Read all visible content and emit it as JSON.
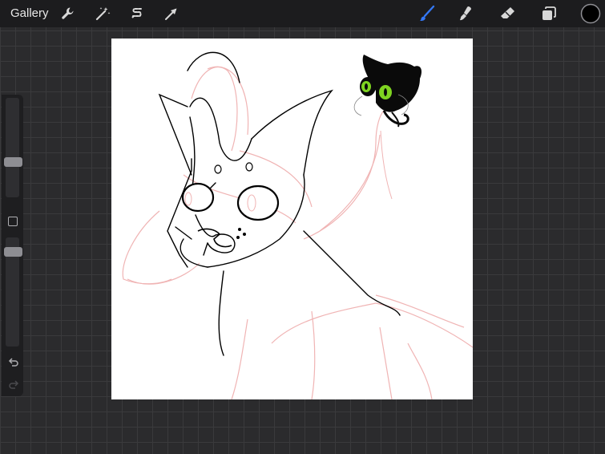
{
  "app": {
    "gallery_label": "Gallery"
  },
  "toolbar": {
    "left_tools": [
      {
        "name": "actions",
        "icon": "wrench-icon"
      },
      {
        "name": "adjustments",
        "icon": "magic-wand-icon"
      },
      {
        "name": "selection",
        "icon": "selection-s-icon"
      },
      {
        "name": "transform",
        "icon": "arrow-cursor-icon"
      }
    ],
    "right_tools": [
      {
        "name": "brush",
        "icon": "brush-icon",
        "active": true
      },
      {
        "name": "smudge",
        "icon": "smudge-icon"
      },
      {
        "name": "eraser",
        "icon": "eraser-icon"
      },
      {
        "name": "layers",
        "icon": "layers-icon"
      },
      {
        "name": "color",
        "icon": "color-swatch-icon"
      }
    ],
    "accent_color": "#3478f6",
    "current_color": "#000000"
  },
  "sidebar": {
    "brush_size_level": 0.34,
    "opacity_level": 0.87,
    "buttons": [
      "modify-square-icon",
      "undo-icon",
      "redo-icon"
    ]
  },
  "canvas": {
    "background": "#ffffff",
    "sketch_color": "#f0b4b4",
    "lineart_color": "#000000"
  }
}
